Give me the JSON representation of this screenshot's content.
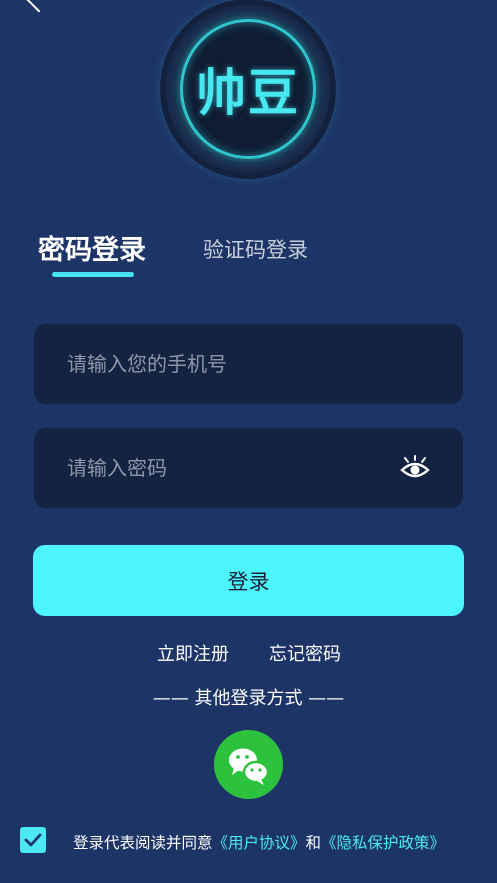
{
  "logo": {
    "text": "帅豆"
  },
  "tabs": [
    {
      "label": "密码登录",
      "active": true
    },
    {
      "label": "验证码登录",
      "active": false
    }
  ],
  "phone_field": {
    "placeholder": "请输入您的手机号",
    "value": ""
  },
  "password_field": {
    "placeholder": "请输入密码",
    "value": ""
  },
  "login_button": {
    "label": "登录"
  },
  "links": {
    "register": "立即注册",
    "forgot": "忘记密码"
  },
  "other_login": {
    "label": "—— 其他登录方式 ——"
  },
  "agreement": {
    "checked": true,
    "prefix": "登录代表阅读并同意",
    "user_agreement": "《用户协议》",
    "and": "和",
    "privacy_policy": "《隐私保护政策》"
  },
  "icons": {
    "back": "chevron-left-icon",
    "eye": "eye-icon",
    "wechat": "wechat-icon",
    "checkbox": "checkmark-icon"
  },
  "colors": {
    "background": "#1d3466",
    "field": "#132341",
    "accent": "#4cf5fb",
    "wechat": "#2cc23e"
  }
}
